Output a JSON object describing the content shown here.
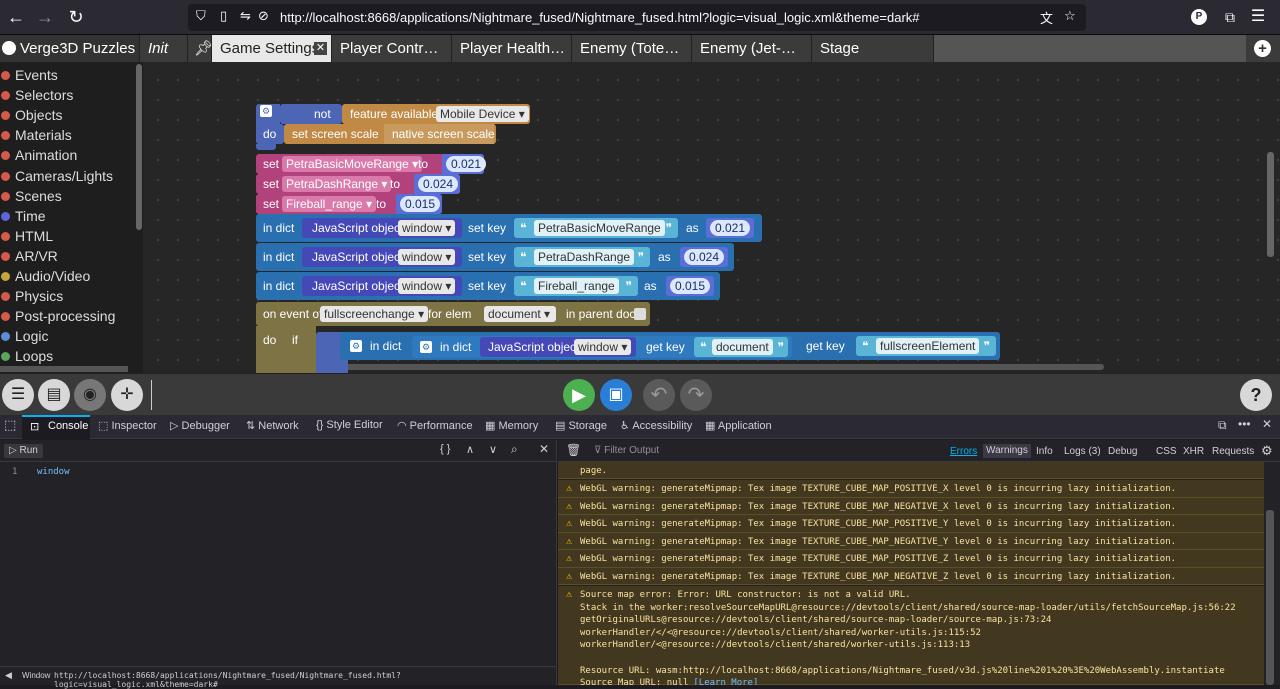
{
  "browser": {
    "url": "http://localhost:8668/applications/Nightmare_fused/Nightmare_fused.html?logic=visual_logic.xml&theme=dark#",
    "profile": "P"
  },
  "tabs": {
    "app": "Verge3D Puzzles",
    "init": "Init",
    "items": [
      "Game Settings",
      "Player Contr…",
      "Player Health…",
      "Enemy (Tote…",
      "Enemy (Jet-…",
      "Stage"
    ]
  },
  "categories": [
    {
      "label": "Events",
      "color": "#d65a4a"
    },
    {
      "label": "Selectors",
      "color": "#d65a4a"
    },
    {
      "label": "Objects",
      "color": "#d65a4a"
    },
    {
      "label": "Materials",
      "color": "#d65a4a"
    },
    {
      "label": "Animation",
      "color": "#d65a4a"
    },
    {
      "label": "Cameras/Lights",
      "color": "#d65a4a"
    },
    {
      "label": "Scenes",
      "color": "#d65a4a"
    },
    {
      "label": "Time",
      "color": "#5b67d8"
    },
    {
      "label": "HTML",
      "color": "#d65a4a"
    },
    {
      "label": "AR/VR",
      "color": "#d65a4a"
    },
    {
      "label": "Audio/Video",
      "color": "#c6a43a"
    },
    {
      "label": "Physics",
      "color": "#d65a4a"
    },
    {
      "label": "Post-processing",
      "color": "#d65a4a"
    },
    {
      "label": "Logic",
      "color": "#5b8dd8"
    },
    {
      "label": "Loops",
      "color": "#5ba55b"
    }
  ],
  "blocks": {
    "if": "if",
    "not": "not",
    "feature": "feature available",
    "mobile": "Mobile Device",
    "do": "do",
    "set_scale": "set screen scale",
    "native": "native screen scale",
    "set": "set",
    "to": "to",
    "var1": "PetraBasicMoveRange",
    "val1": "0.021",
    "var2": "PetraDashRange",
    "val2": "0.024",
    "var3": "Fireball_range",
    "val3": "0.015",
    "in_dict": "in dict",
    "js_object": "JavaScript object",
    "window": "window",
    "set_key": "set key",
    "as": "as",
    "on_event": "on event of",
    "event": "fullscreenchange",
    "for_elem": "for elem",
    "document": "document",
    "in_parent": "in parent doc",
    "get_key": "get key",
    "fs_elem": "fullscreenElement"
  },
  "devtools": {
    "tabs": [
      "Console",
      "Inspector",
      "Debugger",
      "Network",
      "Style Editor",
      "Performance",
      "Memory",
      "Storage",
      "Accessibility",
      "Application"
    ],
    "run": "Run",
    "line": "1",
    "code": "window",
    "filter": "Filter Output",
    "filters": [
      "Errors",
      "Warnings",
      "Info",
      "Logs (3)",
      "Debug",
      "CSS",
      "XHR",
      "Requests"
    ],
    "page_text": "page.",
    "warnings": [
      "WebGL warning: generateMipmap: Tex image TEXTURE_CUBE_MAP_POSITIVE_X level 0 is incurring lazy initialization.",
      "WebGL warning: generateMipmap: Tex image TEXTURE_CUBE_MAP_NEGATIVE_X level 0 is incurring lazy initialization.",
      "WebGL warning: generateMipmap: Tex image TEXTURE_CUBE_MAP_POSITIVE_Y level 0 is incurring lazy initialization.",
      "WebGL warning: generateMipmap: Tex image TEXTURE_CUBE_MAP_NEGATIVE_Y level 0 is incurring lazy initialization.",
      "WebGL warning: generateMipmap: Tex image TEXTURE_CUBE_MAP_POSITIVE_Z level 0 is incurring lazy initialization.",
      "WebGL warning: generateMipmap: Tex image TEXTURE_CUBE_MAP_NEGATIVE_Z level 0 is incurring lazy initialization."
    ],
    "source_map": [
      "Source map error: Error: URL constructor:  is not a valid URL.",
      "Stack in the worker:resolveSourceMapURL@resource://devtools/client/shared/source-map-loader/utils/fetchSourceMap.js:56:22",
      "getOriginalURLs@resource://devtools/client/shared/source-map-loader/source-map.js:73:24",
      "workerHandler/</<@resource://devtools/client/shared/worker-utils.js:115:52",
      "workerHandler/<@resource://devtools/client/shared/worker-utils.js:113:13",
      "",
      "Resource URL: wasm:http://localhost:8668/applications/Nightmare_fused/v3d.js%20line%201%20%3E%20WebAssembly.instantiate"
    ],
    "sm_url_label": "Source Map URL: null",
    "learn_more": "[Learn More]",
    "status_label": "Window",
    "status_url": "http://localhost:8668/applications/Nightmare_fused/Nightmare_fused.html?logic=visual_logic.xml&theme=dark#"
  }
}
